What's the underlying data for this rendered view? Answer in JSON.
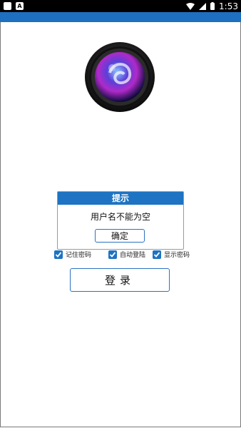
{
  "status_bar": {
    "time": "1:53",
    "notification_icons": [
      "square-icon",
      "a-letter-icon"
    ],
    "notif_letter": "A",
    "right_icons": [
      "wifi-icon",
      "signal-icon",
      "battery-icon"
    ]
  },
  "dialog": {
    "title": "提示",
    "message": "用户名不能为空",
    "ok_label": "确定"
  },
  "options": {
    "remember_password": {
      "label": "记住密码",
      "checked": true
    },
    "auto_login": {
      "label": "自动登陆",
      "checked": true
    },
    "show_password": {
      "label": "显示密码",
      "checked": true
    }
  },
  "login_button": {
    "label": "登录"
  },
  "colors": {
    "accent": "#1e73c3",
    "header_bar": "#1e6fbf"
  }
}
